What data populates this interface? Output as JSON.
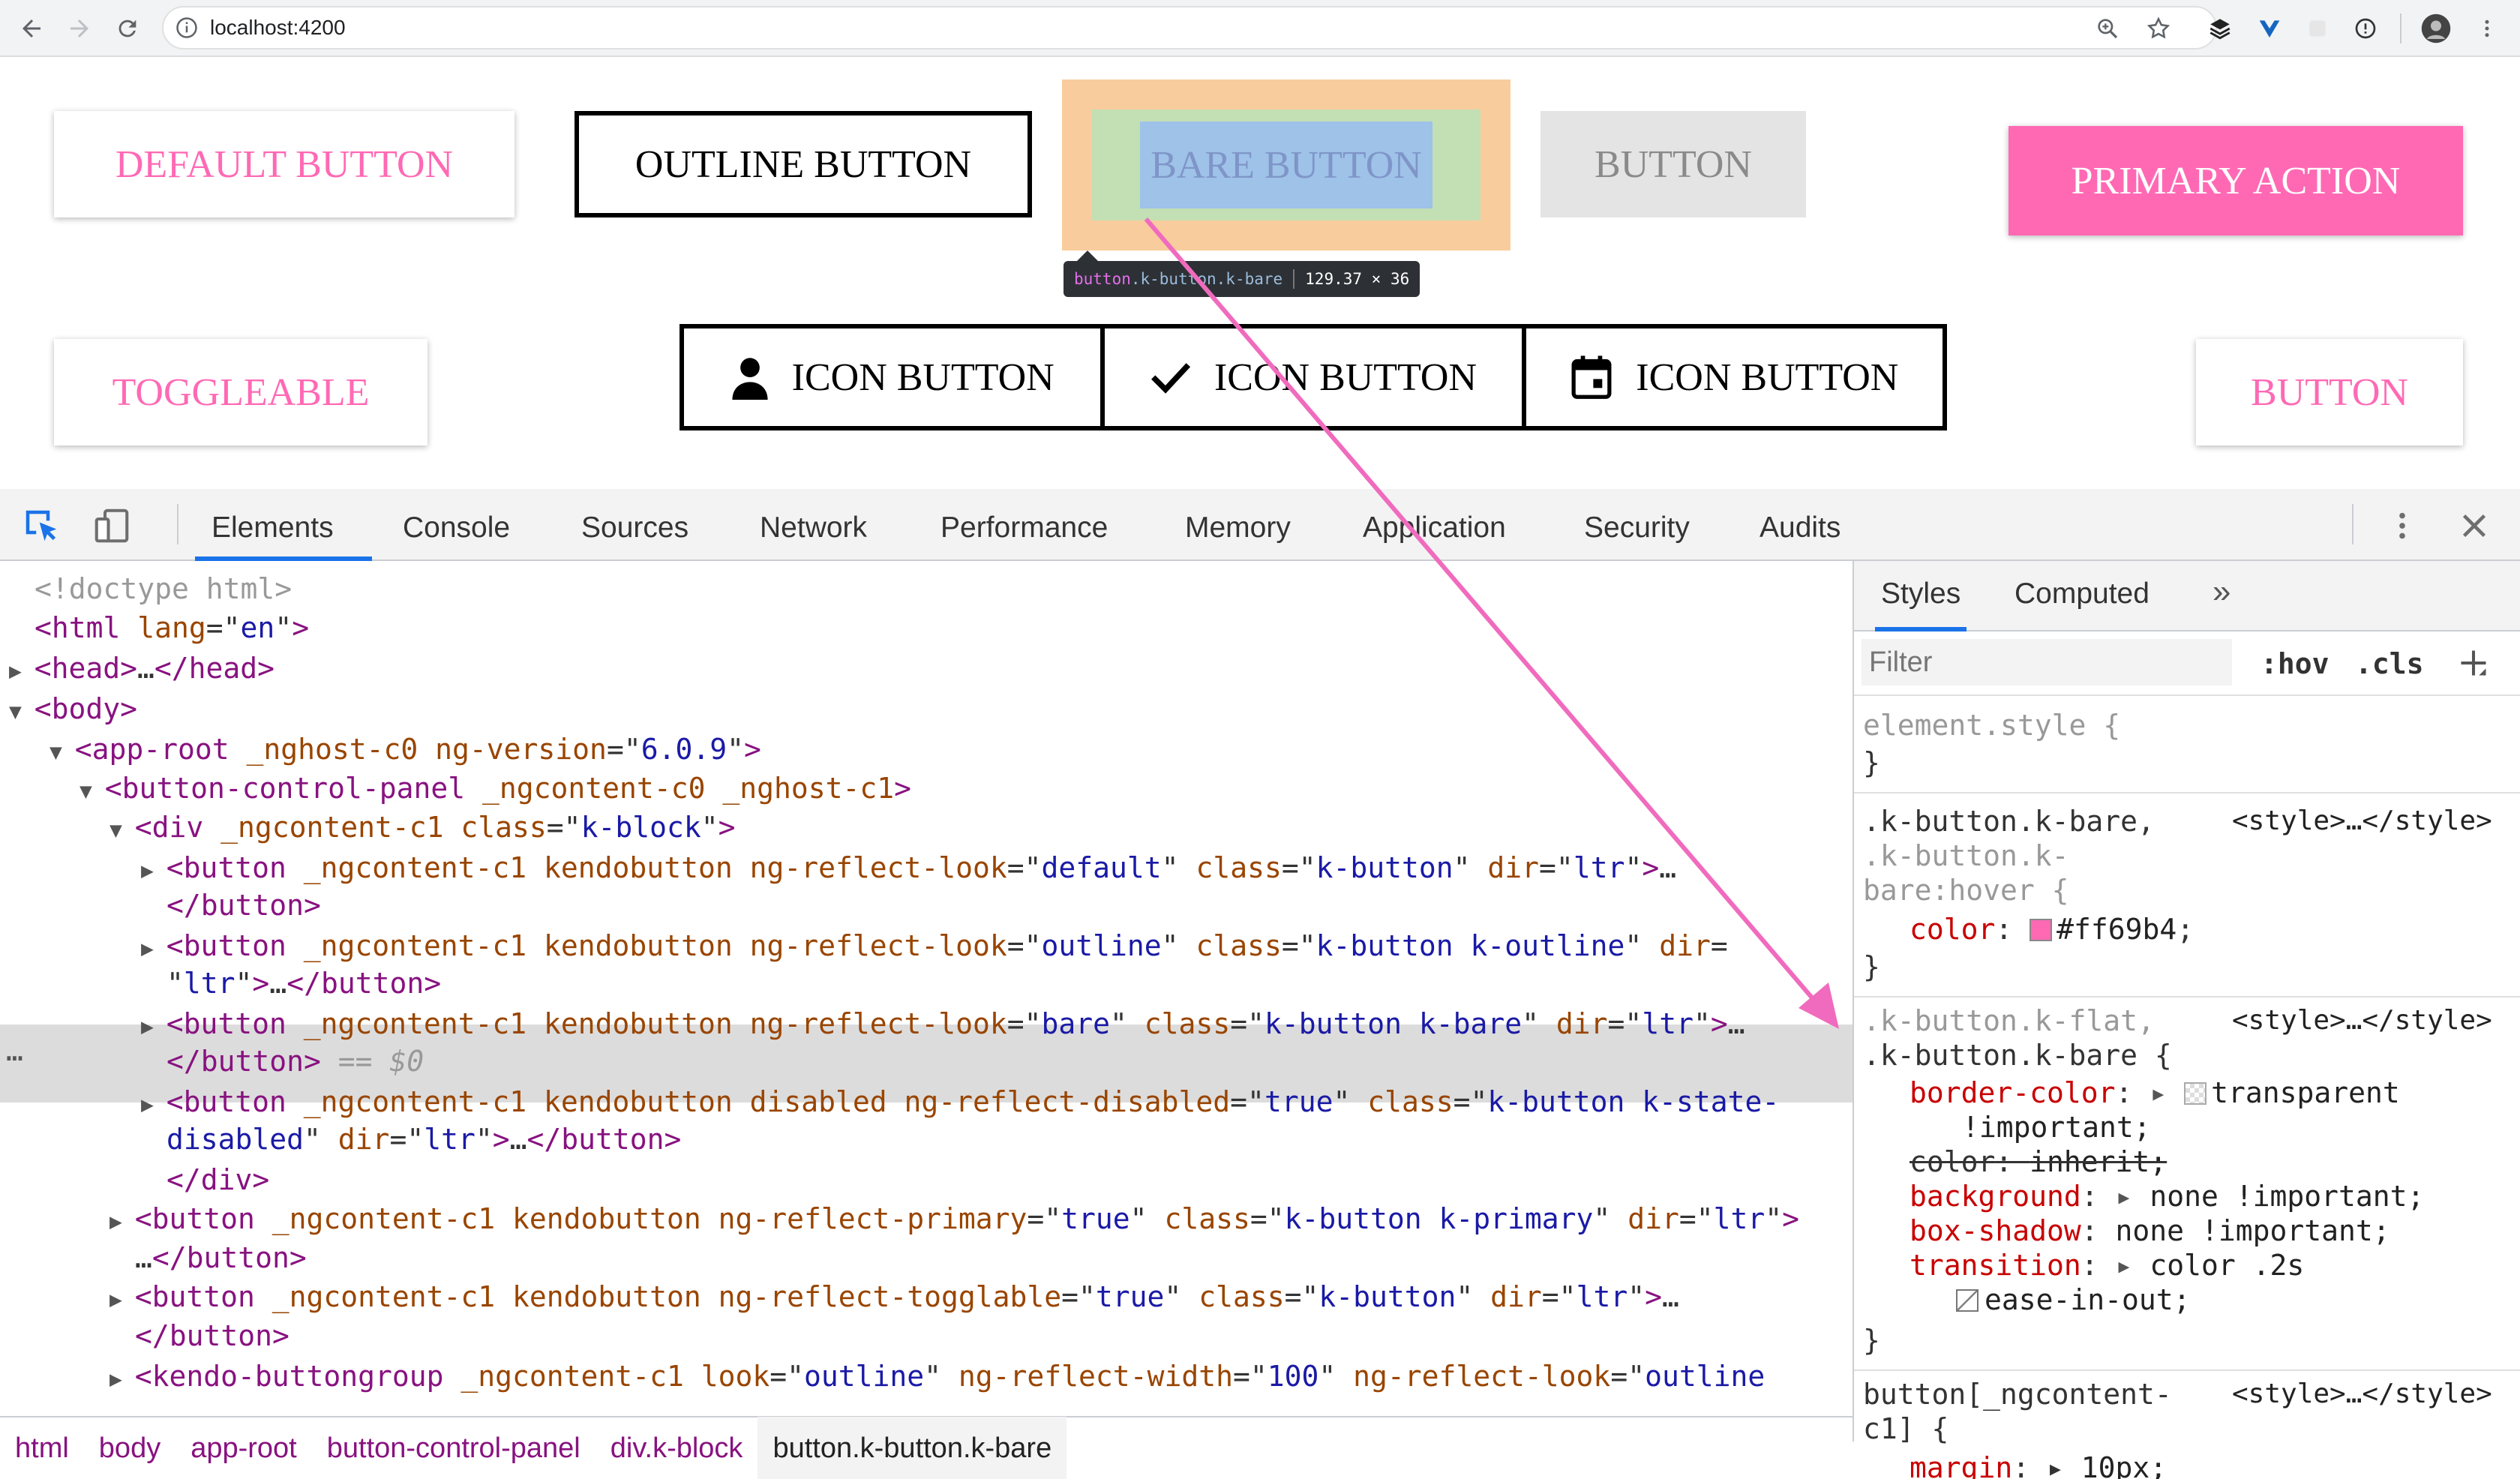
{
  "browser": {
    "url": "localhost:4200"
  },
  "demo": {
    "default_button": "DEFAULT BUTTON",
    "outline_button": "OUTLINE BUTTON",
    "bare_button": "BARE BUTTON",
    "disabled_button": "BUTTON",
    "primary_button": "PRIMARY ACTION",
    "toggleable_button": "TOGGLEABLE",
    "group": [
      "ICON BUTTON",
      "ICON BUTTON",
      "ICON BUTTON"
    ],
    "plain_button": "BUTTON"
  },
  "inspector_tooltip": {
    "tag": "button",
    "classes": ".k-button.k-bare",
    "size": "129.37 × 36"
  },
  "devtools": {
    "tabs": [
      "Elements",
      "Console",
      "Sources",
      "Network",
      "Performance",
      "Memory",
      "Application",
      "Security",
      "Audits"
    ],
    "active_tab": "Elements",
    "dom_lines": [
      {
        "indent": 0,
        "tw": "",
        "parts": [
          [
            "cm",
            "<!doctype html>"
          ]
        ]
      },
      {
        "indent": 0,
        "tw": "",
        "parts": [
          [
            "tg",
            "<html"
          ],
          [
            "at",
            " lang"
          ],
          [
            "tx",
            "=\""
          ],
          [
            "av",
            "en"
          ],
          [
            "tx",
            "\""
          ],
          [
            "tg",
            ">"
          ]
        ]
      },
      {
        "indent": 0,
        "tw": "▶",
        "parts": [
          [
            "tg",
            "<head>"
          ],
          [
            "tx",
            "…"
          ],
          [
            "tg",
            "</head>"
          ]
        ]
      },
      {
        "indent": 0,
        "tw": "▼",
        "parts": [
          [
            "tg",
            "<body>"
          ]
        ]
      },
      {
        "indent": 1,
        "tw": "▼",
        "parts": [
          [
            "tg",
            "<app-root"
          ],
          [
            "at",
            " _nghost-c0 ng-version"
          ],
          [
            "tx",
            "=\""
          ],
          [
            "av",
            "6.0.9"
          ],
          [
            "tx",
            "\""
          ],
          [
            "tg",
            ">"
          ]
        ]
      },
      {
        "indent": 2,
        "tw": "▼",
        "parts": [
          [
            "tg",
            "<button-control-panel"
          ],
          [
            "at",
            " _ngcontent-c0 _nghost-c1"
          ],
          [
            "tg",
            ">"
          ]
        ]
      },
      {
        "indent": 3,
        "tw": "▼",
        "parts": [
          [
            "tg",
            "<div"
          ],
          [
            "at",
            " _ngcontent-c1 class"
          ],
          [
            "tx",
            "=\""
          ],
          [
            "av",
            "k-block"
          ],
          [
            "tx",
            "\""
          ],
          [
            "tg",
            ">"
          ]
        ]
      },
      {
        "indent": 4,
        "tw": "▶",
        "parts": [
          [
            "tg",
            "<button"
          ],
          [
            "at",
            " _ngcontent-c1 kendobutton ng-reflect-look"
          ],
          [
            "tx",
            "=\""
          ],
          [
            "av",
            "default"
          ],
          [
            "tx",
            "\""
          ],
          [
            "at",
            " class"
          ],
          [
            "tx",
            "=\""
          ],
          [
            "av",
            "k-button"
          ],
          [
            "tx",
            "\""
          ],
          [
            "at",
            " dir"
          ],
          [
            "tx",
            "=\""
          ],
          [
            "av",
            "ltr"
          ],
          [
            "tx",
            "\""
          ],
          [
            "tg",
            ">"
          ],
          [
            "tx",
            "…"
          ]
        ]
      },
      {
        "indent": 4,
        "tw": "",
        "parts": [
          [
            "tg",
            "</button>"
          ]
        ]
      },
      {
        "indent": 4,
        "tw": "▶",
        "parts": [
          [
            "tg",
            "<button"
          ],
          [
            "at",
            " _ngcontent-c1 kendobutton ng-reflect-look"
          ],
          [
            "tx",
            "=\""
          ],
          [
            "av",
            "outline"
          ],
          [
            "tx",
            "\""
          ],
          [
            "at",
            " class"
          ],
          [
            "tx",
            "=\""
          ],
          [
            "av",
            "k-button k-outline"
          ],
          [
            "tx",
            "\""
          ],
          [
            "at",
            " dir"
          ],
          [
            "tx",
            "="
          ]
        ]
      },
      {
        "indent": 4,
        "tw": "",
        "parts": [
          [
            "tx",
            "\""
          ],
          [
            "av",
            "ltr"
          ],
          [
            "tx",
            "\""
          ],
          [
            "tg",
            ">"
          ],
          [
            "tx",
            "…"
          ],
          [
            "tg",
            "</button>"
          ]
        ]
      },
      {
        "indent": 4,
        "tw": "▶",
        "parts": [
          [
            "tg",
            "<button"
          ],
          [
            "at",
            " _ngcontent-c1 kendobutton ng-reflect-look"
          ],
          [
            "tx",
            "=\""
          ],
          [
            "av",
            "bare"
          ],
          [
            "tx",
            "\""
          ],
          [
            "at",
            " class"
          ],
          [
            "tx",
            "=\""
          ],
          [
            "av",
            "k-button k-bare"
          ],
          [
            "tx",
            "\""
          ],
          [
            "at",
            " dir"
          ],
          [
            "tx",
            "=\""
          ],
          [
            "av",
            "ltr"
          ],
          [
            "tx",
            "\""
          ],
          [
            "tg",
            ">"
          ],
          [
            "tx",
            "…"
          ]
        ]
      },
      {
        "indent": 4,
        "tw": "",
        "parts": [
          [
            "tg",
            "</button>"
          ],
          [
            "cm",
            " == $0"
          ]
        ]
      },
      {
        "indent": 4,
        "tw": "▶",
        "parts": [
          [
            "tg",
            "<button"
          ],
          [
            "at",
            " _ngcontent-c1 kendobutton disabled ng-reflect-disabled"
          ],
          [
            "tx",
            "=\""
          ],
          [
            "av",
            "true"
          ],
          [
            "tx",
            "\""
          ],
          [
            "at",
            " class"
          ],
          [
            "tx",
            "=\""
          ],
          [
            "av",
            "k-button k-state-"
          ]
        ]
      },
      {
        "indent": 4,
        "tw": "",
        "parts": [
          [
            "av",
            "disabled"
          ],
          [
            "tx",
            "\""
          ],
          [
            "at",
            " dir"
          ],
          [
            "tx",
            "=\""
          ],
          [
            "av",
            "ltr"
          ],
          [
            "tx",
            "\""
          ],
          [
            "tg",
            ">"
          ],
          [
            "tx",
            "…"
          ],
          [
            "tg",
            "</button>"
          ]
        ]
      },
      {
        "indent": 4,
        "tw": "",
        "parts": [
          [
            "tg",
            "</div>"
          ]
        ]
      },
      {
        "indent": 3,
        "tw": "▶",
        "parts": [
          [
            "tg",
            "<button"
          ],
          [
            "at",
            " _ngcontent-c1 kendobutton ng-reflect-primary"
          ],
          [
            "tx",
            "=\""
          ],
          [
            "av",
            "true"
          ],
          [
            "tx",
            "\""
          ],
          [
            "at",
            " class"
          ],
          [
            "tx",
            "=\""
          ],
          [
            "av",
            "k-button k-primary"
          ],
          [
            "tx",
            "\""
          ],
          [
            "at",
            " dir"
          ],
          [
            "tx",
            "=\""
          ],
          [
            "av",
            "ltr"
          ],
          [
            "tx",
            "\""
          ],
          [
            "tg",
            ">"
          ]
        ]
      },
      {
        "indent": 3,
        "tw": "",
        "parts": [
          [
            "tx",
            "…"
          ],
          [
            "tg",
            "</button>"
          ]
        ]
      },
      {
        "indent": 3,
        "tw": "▶",
        "parts": [
          [
            "tg",
            "<button"
          ],
          [
            "at",
            " _ngcontent-c1 kendobutton ng-reflect-togglable"
          ],
          [
            "tx",
            "=\""
          ],
          [
            "av",
            "true"
          ],
          [
            "tx",
            "\""
          ],
          [
            "at",
            " class"
          ],
          [
            "tx",
            "=\""
          ],
          [
            "av",
            "k-button"
          ],
          [
            "tx",
            "\""
          ],
          [
            "at",
            " dir"
          ],
          [
            "tx",
            "=\""
          ],
          [
            "av",
            "ltr"
          ],
          [
            "tx",
            "\""
          ],
          [
            "tg",
            ">"
          ],
          [
            "tx",
            "…"
          ]
        ]
      },
      {
        "indent": 3,
        "tw": "",
        "parts": [
          [
            "tg",
            "</button>"
          ]
        ]
      },
      {
        "indent": 3,
        "tw": "▶",
        "parts": [
          [
            "tg",
            "<kendo-buttongroup"
          ],
          [
            "at",
            " _ngcontent-c1 look"
          ],
          [
            "tx",
            "=\""
          ],
          [
            "av",
            "outline"
          ],
          [
            "tx",
            "\""
          ],
          [
            "at",
            " ng-reflect-width"
          ],
          [
            "tx",
            "=\""
          ],
          [
            "av",
            "100"
          ],
          [
            "tx",
            "\""
          ],
          [
            "at",
            " ng-reflect-look"
          ],
          [
            "tx",
            "=\""
          ],
          [
            "av",
            "outline"
          ]
        ]
      }
    ],
    "breadcrumbs": [
      "html",
      "body",
      "app-root",
      "button-control-panel",
      "div.k-block",
      "button.k-button.k-bare"
    ],
    "sidebar_tabs": [
      "Styles",
      "Computed",
      "»"
    ],
    "filter_placeholder": "Filter",
    "hov": ":hov",
    "cls": ".cls",
    "style_src": "<style>…</style>",
    "rule_element_style": "element.style {",
    "rule1_selector_1": ".k-button.k-bare,",
    "rule1_selector_2": ".k-button.k-",
    "rule1_selector_3": "bare:hover {",
    "rule1_prop": "color",
    "rule1_val": "#ff69b4",
    "rule2_selector_1": ".k-button.k-flat,",
    "rule2_selector_2": ".k-button.k-bare {",
    "rule2_props": [
      {
        "name": "border-color",
        "value": "transparent",
        "extra": "!important;",
        "swatch": "transparent",
        "arrow": true,
        "strike": false
      },
      {
        "name": "color",
        "value": "inherit;",
        "extra": "",
        "swatch": "",
        "arrow": false,
        "strike": true
      },
      {
        "name": "background",
        "value": "none !important;",
        "extra": "",
        "swatch": "",
        "arrow": true,
        "strike": false
      },
      {
        "name": "box-shadow",
        "value": "none !important;",
        "extra": "",
        "swatch": "",
        "arrow": false,
        "strike": false
      },
      {
        "name": "transition",
        "value": "color .2s",
        "extra": "ease-in-out;",
        "swatch": "",
        "arrow": true,
        "strike": false
      }
    ],
    "rule3_selector_1": "button[_ngcontent-",
    "rule3_selector_2": "c1] {",
    "rule3_prop": "margin",
    "rule3_val": "10px;",
    "close_brace": "}",
    "dots": "…"
  },
  "colors": {
    "accent_pink": "#ff69b4",
    "devtools_blue": "#1a73e8"
  }
}
